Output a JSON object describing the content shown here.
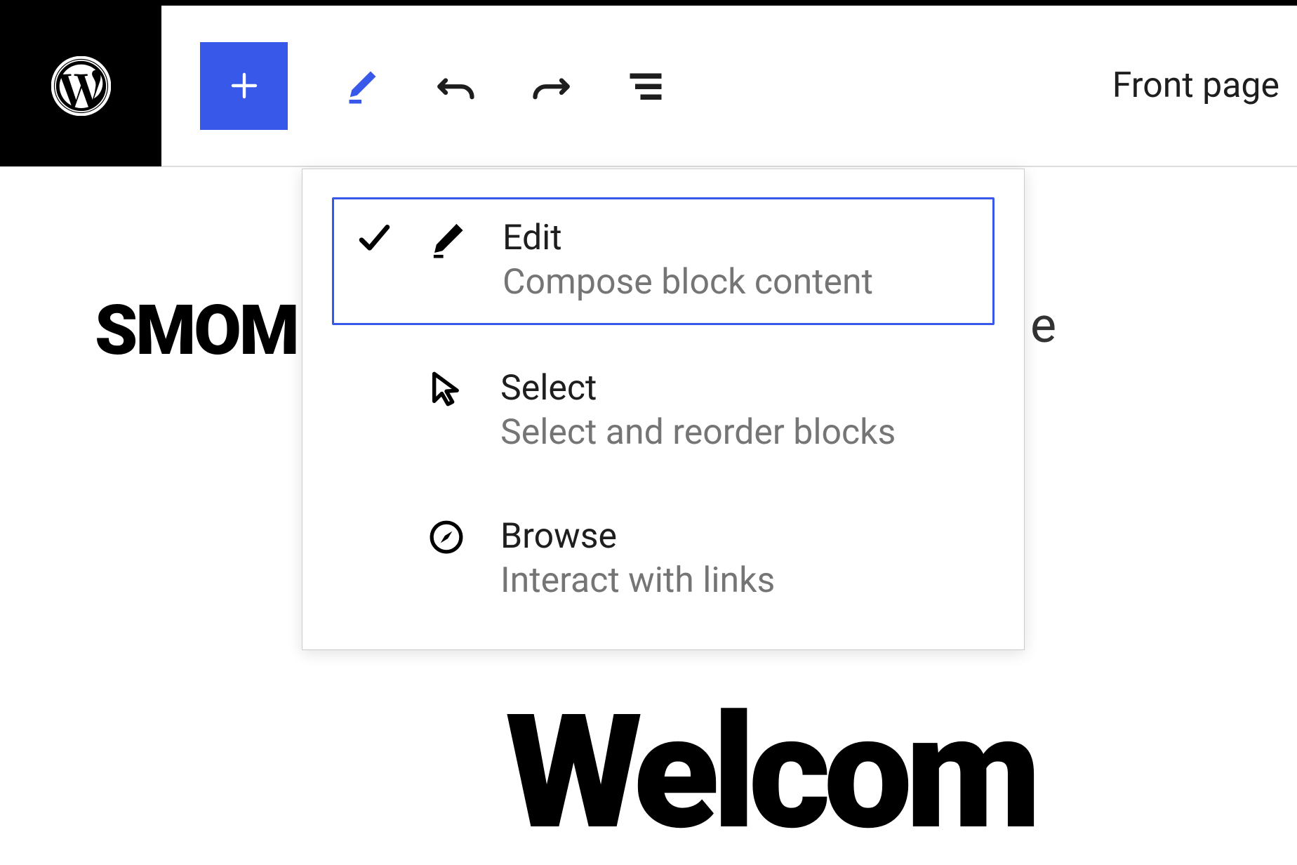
{
  "toolbar": {
    "page_title": "Front page"
  },
  "content": {
    "site_title_partial": "SMOM",
    "trailing_char": "e",
    "welcome_partial": "Welcom"
  },
  "dropdown": {
    "items": [
      {
        "title": "Edit",
        "desc": "Compose block content",
        "selected": true,
        "icon": "pencil"
      },
      {
        "title": "Select",
        "desc": "Select and reorder blocks",
        "selected": false,
        "icon": "cursor"
      },
      {
        "title": "Browse",
        "desc": "Interact with links",
        "selected": false,
        "icon": "compass"
      }
    ]
  }
}
